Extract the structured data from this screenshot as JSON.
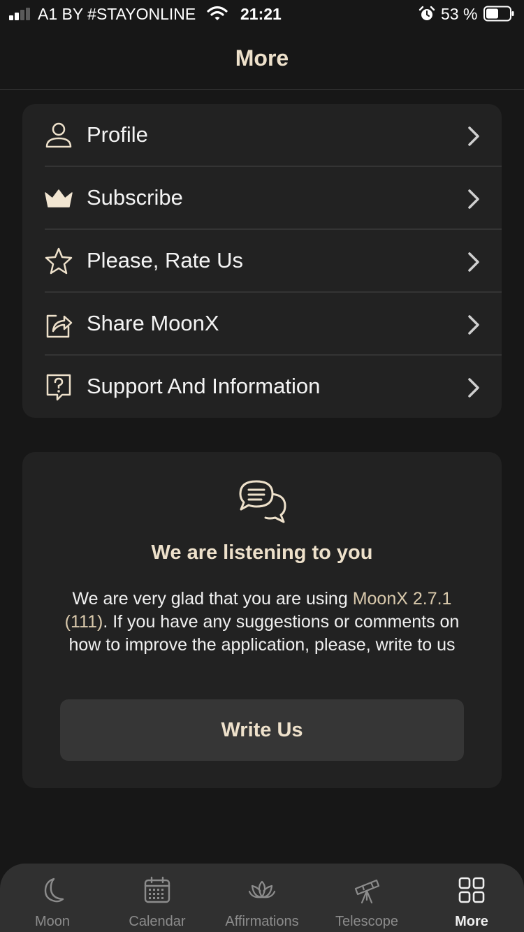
{
  "status_bar": {
    "carrier": "A1 BY #STAYONLINE",
    "time": "21:21",
    "battery": "53 %"
  },
  "header": {
    "title": "More"
  },
  "menu": [
    {
      "label": "Profile",
      "icon": "person-icon"
    },
    {
      "label": "Subscribe",
      "icon": "crown-icon"
    },
    {
      "label": "Please, Rate Us",
      "icon": "star-icon"
    },
    {
      "label": "Share MoonX",
      "icon": "share-icon"
    },
    {
      "label": "Support And Information",
      "icon": "question-icon"
    }
  ],
  "feedback": {
    "icon": "chat-bubbles-icon",
    "title": "We are listening to you",
    "text_before": "We are very glad that you are using ",
    "text_accent": "MoonX 2.7.1 (111)",
    "text_after": ". If you have any suggestions or comments on how to improve the application, please, write to us",
    "button": "Write Us"
  },
  "tabs": [
    {
      "label": "Moon",
      "icon": "moon-icon",
      "active": false
    },
    {
      "label": "Calendar",
      "icon": "calendar-icon",
      "active": false
    },
    {
      "label": "Affirmations",
      "icon": "lotus-icon",
      "active": false
    },
    {
      "label": "Telescope",
      "icon": "telescope-icon",
      "active": false
    },
    {
      "label": "More",
      "icon": "grid-icon",
      "active": true
    }
  ],
  "colors": {
    "background": "#171717",
    "card": "#222222",
    "accent_text": "#eee1cb",
    "tab_bar": "#303030",
    "active_tab": "#f0f0f0",
    "inactive_tab": "#8c8c8c"
  }
}
